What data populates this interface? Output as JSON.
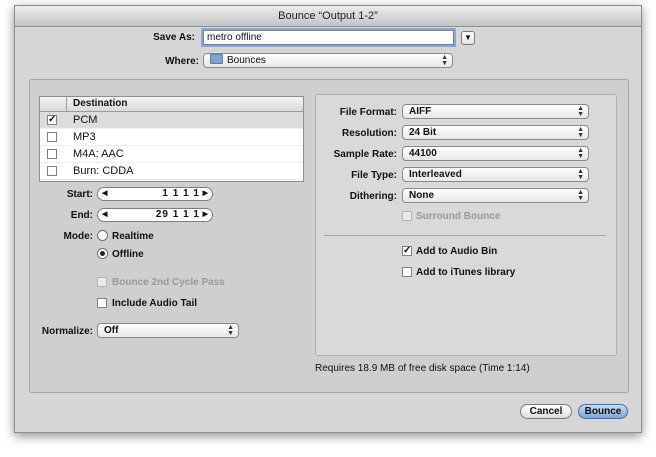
{
  "window": {
    "title": "Bounce “Output 1-2”"
  },
  "save_as": {
    "label": "Save As:",
    "value": "metro offline"
  },
  "where": {
    "label": "Where:",
    "value": "Bounces"
  },
  "destination": {
    "header": "Destination",
    "rows": [
      {
        "label": "PCM",
        "checked": true
      },
      {
        "label": "MP3",
        "checked": false
      },
      {
        "label": "M4A: AAC",
        "checked": false
      },
      {
        "label": "Burn: CDDA",
        "checked": false
      }
    ]
  },
  "start": {
    "label": "Start:",
    "value": "1  1  1  1"
  },
  "end": {
    "label": "End:",
    "value": "29  1  1  1"
  },
  "mode": {
    "label": "Mode:",
    "options": [
      {
        "label": "Realtime",
        "selected": false
      },
      {
        "label": "Offline",
        "selected": true
      }
    ]
  },
  "bounce_2nd_cycle": {
    "label": "Bounce 2nd Cycle Pass",
    "checked": false,
    "enabled": false
  },
  "include_audio_tail": {
    "label": "Include Audio Tail",
    "checked": false
  },
  "normalize": {
    "label": "Normalize:",
    "value": "Off"
  },
  "file_format": {
    "label": "File Format:",
    "value": "AIFF"
  },
  "resolution": {
    "label": "Resolution:",
    "value": "24 Bit"
  },
  "sample_rate": {
    "label": "Sample Rate:",
    "value": "44100"
  },
  "file_type": {
    "label": "File Type:",
    "value": "Interleaved"
  },
  "dithering": {
    "label": "Dithering:",
    "value": "None"
  },
  "surround_bounce": {
    "label": "Surround Bounce",
    "checked": false,
    "enabled": false
  },
  "add_to_audio_bin": {
    "label": "Add to Audio Bin",
    "checked": true
  },
  "add_to_itunes": {
    "label": "Add to iTunes library",
    "checked": false
  },
  "disk_info": "Requires 18.9 MB of free disk space  (Time 1:14)",
  "buttons": {
    "cancel": "Cancel",
    "bounce": "Bounce"
  },
  "colors": {
    "accent": "#86a9d9",
    "default_button": "#7fa6d3"
  }
}
